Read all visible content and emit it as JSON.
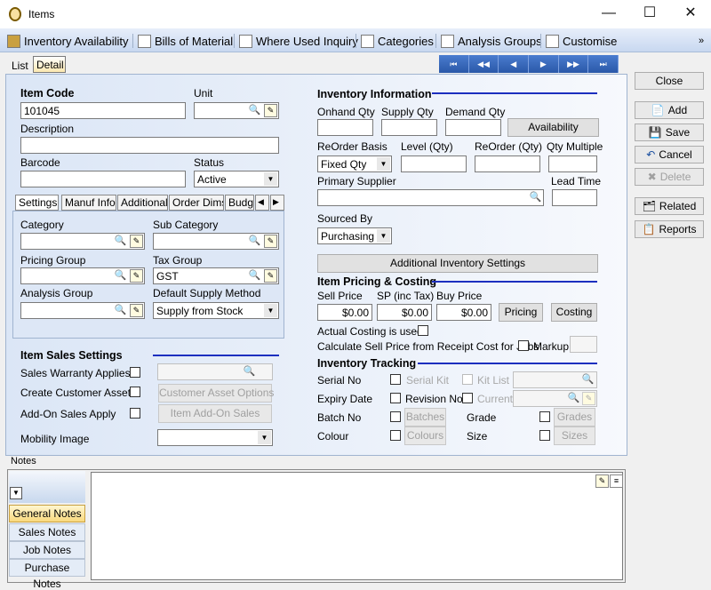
{
  "window": {
    "title": "Items",
    "minimize": "—",
    "maximize": "☐",
    "close": "✕"
  },
  "toolbar": {
    "items": [
      "Inventory Availability",
      "Bills of Material",
      "Where Used Inquiry",
      "Categories",
      "Analysis Groups",
      "Customise"
    ],
    "more": "»"
  },
  "tabs": {
    "list": "List",
    "detail": "Detail"
  },
  "nav": {
    "first": "⏮",
    "prev_page": "◀◀",
    "prev": "◀",
    "next": "▶",
    "next_page": "▶▶",
    "last": "⏭"
  },
  "item": {
    "code_label": "Item Code",
    "code": "101045",
    "unit_label": "Unit",
    "unit": "",
    "description_label": "Description",
    "description": "",
    "barcode_label": "Barcode",
    "barcode": "",
    "status_label": "Status",
    "status": "Active"
  },
  "subtabs": [
    "Settings",
    "Manuf Info",
    "Additional",
    "Order Dims",
    "Budg"
  ],
  "settings": {
    "category_label": "Category",
    "category": "",
    "subcategory_label": "Sub Category",
    "subcategory": "",
    "pricing_group_label": "Pricing Group",
    "pricing_group": "",
    "tax_group_label": "Tax Group",
    "tax_group": "GST",
    "analysis_group_label": "Analysis Group",
    "analysis_group": "",
    "supply_method_label": "Default Supply Method",
    "supply_method": "Supply from Stock"
  },
  "sales": {
    "heading": "Item Sales Settings",
    "warranty": "Sales Warranty Applies",
    "customer_asset": "Create Customer Asset",
    "addon": "Add-On Sales Apply",
    "mobility": "Mobility Image",
    "customer_asset_btn": "Customer Asset Options",
    "addon_btn": "Item Add-On Sales"
  },
  "inventory": {
    "heading": "Inventory Information",
    "onhand": "Onhand Qty",
    "supply": "Supply Qty",
    "demand": "Demand Qty",
    "availability_btn": "Availability",
    "reorder_basis_label": "ReOrder Basis",
    "reorder_basis": "Fixed Qty",
    "level": "Level (Qty)",
    "reorder": "ReOrder (Qty)",
    "qty_multiple": "Qty Multiple",
    "primary_supplier": "Primary Supplier",
    "lead_time": "Lead Time",
    "sourced_by_label": "Sourced By",
    "sourced_by": "Purchasing",
    "additional_btn": "Additional Inventory Settings"
  },
  "pricing": {
    "heading": "Item Pricing & Costing",
    "sell": "Sell Price",
    "sp_inc": "SP (inc Tax)",
    "buy": "Buy Price",
    "sell_val": "$0.00",
    "sp_val": "$0.00",
    "buy_val": "$0.00",
    "pricing_btn": "Pricing",
    "costing_btn": "Costing",
    "actual_costing": "Actual Costing is used",
    "calc": "Calculate Sell Price from Receipt Cost for Jobs",
    "markup": "Markup"
  },
  "tracking": {
    "heading": "Inventory Tracking",
    "serial": "Serial No",
    "serial_kit": "Serial Kit",
    "kit_list": "Kit List",
    "expiry": "Expiry Date",
    "revision": "Revision No",
    "current": "Current",
    "batch": "Batch No",
    "batches_btn": "Batches",
    "grade": "Grade",
    "grades_btn": "Grades",
    "colour": "Colour",
    "colours_btn": "Colours",
    "size": "Size",
    "sizes_btn": "Sizes"
  },
  "side": {
    "close": "Close",
    "add": "Add",
    "save": "Save",
    "cancel": "Cancel",
    "delete": "Delete",
    "related": "Related",
    "reports": "Reports"
  },
  "notes": {
    "label": "Notes",
    "tabs": [
      "General Notes",
      "Sales Notes",
      "Job Notes",
      "Purchase Notes"
    ]
  }
}
